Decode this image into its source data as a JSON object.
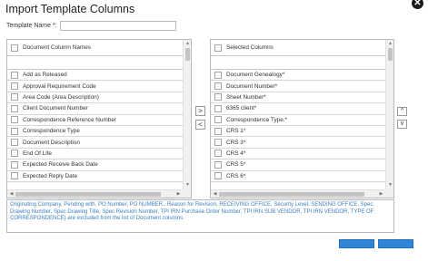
{
  "dialog": {
    "title": "Import Template Columns",
    "close_icon": "close-icon"
  },
  "template_name": {
    "label": "Template Name *:",
    "value": ""
  },
  "left_list": {
    "header": "Document Column Names",
    "items": [
      "Add as Released",
      "Approval Requirement Code",
      "Area Code (Area Description)",
      "Client Document Number",
      "Correspondence Reference Number",
      "Correspondence Type",
      "Document Description",
      "End Of Life",
      "Expected Receive Back Date",
      "Expected Reply Date"
    ]
  },
  "right_list": {
    "header": "Selected Columns",
    "items": [
      "Document Genealogy*",
      "Document Number*",
      "Sheet Number*",
      "6365 client*",
      "Correspondence Type.*",
      "CRS 1*",
      "CRS 3*",
      "CRS 4*",
      "CRS 5*",
      "CRS 6*"
    ]
  },
  "move_buttons": {
    "add": ">",
    "remove": "<",
    "up": "^",
    "down": "v"
  },
  "note": "Originating Company, Pending with, PO Number, PO NUMBER., Reason for Revision, RECEIVING OFFICE, Security Level, SENDING OFFICE, Spec Drawing Number, Spec Drawing Title, Spec Revision Number, TPI IRN Purchase Order Number, TPI IRN SUB VENDOR, TPI IRN VENDOR, TYPE OF CORRESPONDENCE) are excluded from the list of Document columns.",
  "colors": {
    "accent": "#2f86d6",
    "note_text": "#3b7fc1"
  }
}
